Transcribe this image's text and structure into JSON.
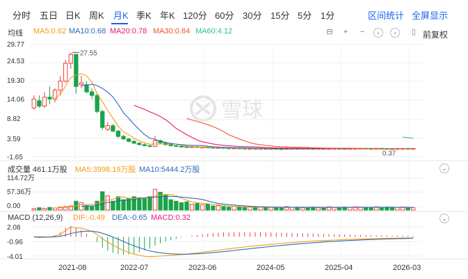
{
  "tabs": [
    {
      "label": "分时",
      "active": false
    },
    {
      "label": "五日",
      "active": false
    },
    {
      "label": "日K",
      "active": false
    },
    {
      "label": "周K",
      "active": false
    },
    {
      "label": "月K",
      "active": true
    },
    {
      "label": "季K",
      "active": false
    },
    {
      "label": "年K",
      "active": false
    },
    {
      "label": "120分",
      "active": false
    },
    {
      "label": "60分",
      "active": false
    },
    {
      "label": "30分",
      "active": false
    },
    {
      "label": "15分",
      "active": false
    },
    {
      "label": "5分",
      "active": false
    },
    {
      "label": "1分",
      "active": false
    }
  ],
  "links": {
    "range_stats": "区间统计",
    "fullscreen": "全屏显示"
  },
  "ma": {
    "label": "均线",
    "ma5": "MA5:0.62",
    "ma10": "MA10:0.68",
    "ma20": "MA20:0.78",
    "ma30": "MA30:0.84",
    "ma60": "MA60:4.12"
  },
  "toolbar": {
    "adjust": "前复权"
  },
  "price_axis": [
    "29.77",
    "24.53",
    "19.30",
    "14.06",
    "8.82",
    "3.59",
    "-1.65"
  ],
  "annotations": {
    "high": "27.55",
    "low": "0.37"
  },
  "volume": {
    "label": "成交量 461.1万股",
    "ma5": "MA5:3998.19万股",
    "ma10": "MA10:5444.2万股",
    "axis": [
      "114.72万",
      "57.36万",
      "0.00"
    ]
  },
  "macd": {
    "label": "MACD (12,26,9)",
    "dif": "DIF:-0.49",
    "dea": "DEA:-0.65",
    "macd": "MACD:0.32",
    "axis": [
      "2.08",
      "-0.96",
      "-4.01"
    ]
  },
  "x_axis": [
    "2021-08",
    "2022-07",
    "2023-06",
    "2024-05",
    "2025-04",
    "2026-03"
  ],
  "watermark": "雪球",
  "colors": {
    "up": "#e8413e",
    "down": "#1aa34a",
    "accent": "#1764e8",
    "ma5": "#f39c12",
    "ma10": "#2d6bb8",
    "ma20": "#e6187a",
    "ma30": "#f0542d",
    "ma60": "#2ec27e"
  },
  "chart_data": {
    "type": "candlestick",
    "period": "monthly",
    "price_range": [
      -1.65,
      29.77
    ],
    "candles": [
      {
        "o": 12.0,
        "c": 14.5,
        "h": 15.5,
        "l": 11.5
      },
      {
        "o": 14.0,
        "c": 12.5,
        "h": 15.5,
        "l": 12.0
      },
      {
        "o": 12.5,
        "c": 15.0,
        "h": 16.5,
        "l": 12.0
      },
      {
        "o": 15.0,
        "c": 14.5,
        "h": 18.0,
        "l": 13.0
      },
      {
        "o": 14.5,
        "c": 17.0,
        "h": 17.5,
        "l": 13.5
      },
      {
        "o": 17.0,
        "c": 19.5,
        "h": 21.0,
        "l": 15.5
      },
      {
        "o": 19.5,
        "c": 24.5,
        "h": 25.5,
        "l": 19.0
      },
      {
        "o": 24.5,
        "c": 27.0,
        "h": 27.55,
        "l": 23.0
      },
      {
        "o": 27.0,
        "c": 18.0,
        "h": 27.0,
        "l": 16.0
      },
      {
        "o": 18.5,
        "c": 19.0,
        "h": 21.0,
        "l": 17.5
      },
      {
        "o": 18.5,
        "c": 16.5,
        "h": 19.5,
        "l": 16.0
      },
      {
        "o": 16.5,
        "c": 15.5,
        "h": 17.5,
        "l": 14.5
      },
      {
        "o": 15.5,
        "c": 11.0,
        "h": 16.0,
        "l": 10.5
      },
      {
        "o": 11.0,
        "c": 6.5,
        "h": 11.5,
        "l": 5.8
      },
      {
        "o": 6.0,
        "c": 7.0,
        "h": 8.0,
        "l": 5.5
      },
      {
        "o": 7.0,
        "c": 5.5,
        "h": 7.5,
        "l": 5.2
      },
      {
        "o": 5.5,
        "c": 4.0,
        "h": 5.8,
        "l": 3.5
      },
      {
        "o": 4.0,
        "c": 3.3,
        "h": 4.5,
        "l": 3.0
      },
      {
        "o": 3.3,
        "c": 2.6,
        "h": 3.6,
        "l": 2.3
      },
      {
        "o": 2.6,
        "c": 2.1,
        "h": 3.0,
        "l": 1.8
      },
      {
        "o": 2.1,
        "c": 1.7,
        "h": 2.4,
        "l": 1.5
      },
      {
        "o": 1.7,
        "c": 1.4,
        "h": 2.0,
        "l": 1.2
      },
      {
        "o": 1.4,
        "c": 1.2,
        "h": 1.6,
        "l": 0.9
      },
      {
        "o": 1.2,
        "c": 2.8,
        "h": 4.2,
        "l": 1.1
      },
      {
        "o": 2.8,
        "c": 2.2,
        "h": 3.1,
        "l": 1.8
      },
      {
        "o": 2.2,
        "c": 1.7,
        "h": 2.5,
        "l": 1.4
      },
      {
        "o": 1.7,
        "c": 1.4,
        "h": 1.9,
        "l": 1.2
      },
      {
        "o": 1.4,
        "c": 1.2,
        "h": 1.6,
        "l": 1.0
      },
      {
        "o": 1.2,
        "c": 1.1,
        "h": 1.4,
        "l": 0.9
      },
      {
        "o": 1.1,
        "c": 0.9,
        "h": 1.3,
        "l": 0.8
      },
      {
        "o": 0.9,
        "c": 1.1,
        "h": 1.3,
        "l": 0.8
      },
      {
        "o": 1.1,
        "c": 0.9,
        "h": 1.2,
        "l": 0.8
      },
      {
        "o": 0.9,
        "c": 1.0,
        "h": 1.2,
        "l": 0.8
      },
      {
        "o": 1.0,
        "c": 0.9,
        "h": 1.2,
        "l": 0.8
      },
      {
        "o": 0.9,
        "c": 0.8,
        "h": 1.0,
        "l": 0.7
      },
      {
        "o": 0.8,
        "c": 0.85,
        "h": 1.0,
        "l": 0.7
      },
      {
        "o": 0.85,
        "c": 0.75,
        "h": 0.95,
        "l": 0.65
      },
      {
        "o": 0.75,
        "c": 0.7,
        "h": 0.85,
        "l": 0.6
      },
      {
        "o": 0.7,
        "c": 0.72,
        "h": 0.85,
        "l": 0.6
      },
      {
        "o": 0.72,
        "c": 0.65,
        "h": 0.8,
        "l": 0.55
      },
      {
        "o": 0.65,
        "c": 0.6,
        "h": 0.75,
        "l": 0.5
      },
      {
        "o": 0.6,
        "c": 0.62,
        "h": 0.7,
        "l": 0.5
      },
      {
        "o": 0.62,
        "c": 0.55,
        "h": 0.7,
        "l": 0.45
      },
      {
        "o": 0.55,
        "c": 0.6,
        "h": 0.7,
        "l": 0.5
      },
      {
        "o": 0.6,
        "c": 0.55,
        "h": 0.65,
        "l": 0.45
      },
      {
        "o": 0.55,
        "c": 0.58,
        "h": 0.66,
        "l": 0.48
      },
      {
        "o": 0.58,
        "c": 0.52,
        "h": 0.62,
        "l": 0.45
      },
      {
        "o": 0.52,
        "c": 0.5,
        "h": 0.58,
        "l": 0.42
      },
      {
        "o": 0.5,
        "c": 0.55,
        "h": 0.9,
        "l": 0.45
      },
      {
        "o": 0.55,
        "c": 0.6,
        "h": 0.7,
        "l": 0.5
      },
      {
        "o": 0.6,
        "c": 0.58,
        "h": 0.66,
        "l": 0.5
      },
      {
        "o": 0.58,
        "c": 0.62,
        "h": 0.7,
        "l": 0.52
      },
      {
        "o": 0.62,
        "c": 0.6,
        "h": 0.68,
        "l": 0.52
      },
      {
        "o": 0.6,
        "c": 0.58,
        "h": 0.66,
        "l": 0.5
      },
      {
        "o": 0.58,
        "c": 0.6,
        "h": 0.66,
        "l": 0.5
      },
      {
        "o": 0.6,
        "c": 0.57,
        "h": 0.65,
        "l": 0.5
      },
      {
        "o": 0.57,
        "c": 0.6,
        "h": 0.66,
        "l": 0.5
      },
      {
        "o": 0.6,
        "c": 0.62,
        "h": 0.7,
        "l": 0.52
      },
      {
        "o": 0.62,
        "c": 0.6,
        "h": 0.68,
        "l": 0.52
      },
      {
        "o": 0.6,
        "c": 0.58,
        "h": 0.66,
        "l": 0.5
      },
      {
        "o": 0.58,
        "c": 0.6,
        "h": 0.66,
        "l": 0.5
      },
      {
        "o": 0.6,
        "c": 0.62,
        "h": 0.7,
        "l": 0.52
      },
      {
        "o": 0.62,
        "c": 0.66,
        "h": 0.72,
        "l": 0.56
      },
      {
        "o": 0.66,
        "c": 0.6,
        "h": 0.7,
        "l": 0.52
      },
      {
        "o": 0.6,
        "c": 0.58,
        "h": 0.66,
        "l": 0.5
      },
      {
        "o": 0.58,
        "c": 0.62,
        "h": 0.68,
        "l": 0.52
      },
      {
        "o": 0.62,
        "c": 0.6,
        "h": 0.7,
        "l": 0.52
      },
      {
        "o": 0.6,
        "c": 0.58,
        "h": 0.66,
        "l": 0.5
      },
      {
        "o": 0.58,
        "c": 0.55,
        "h": 0.62,
        "l": 0.37
      },
      {
        "o": 0.55,
        "c": 0.6,
        "h": 0.68,
        "l": 0.5
      },
      {
        "o": 0.6,
        "c": 0.62,
        "h": 0.7,
        "l": 0.55
      },
      {
        "o": 0.62,
        "c": 0.6,
        "h": 0.66,
        "l": 0.55
      },
      {
        "o": 0.6,
        "c": 0.62,
        "h": 0.68,
        "l": 0.56
      }
    ],
    "ma_lines": {
      "ma60": [
        [
          70,
          3.8
        ],
        [
          73,
          3.5
        ]
      ]
    },
    "volume_range": [
      0,
      114.72
    ],
    "volume": [
      5,
      8,
      6,
      9,
      7,
      10,
      12,
      14,
      30,
      25,
      15,
      12,
      30,
      62,
      48,
      30,
      45,
      35,
      40,
      45,
      42,
      38,
      45,
      70,
      60,
      50,
      35,
      30,
      25,
      28,
      20,
      22,
      18,
      20,
      14,
      15,
      12,
      10,
      13,
      11,
      9,
      10,
      8,
      11,
      9,
      10,
      8,
      7,
      12,
      9,
      10,
      8,
      9,
      10,
      8,
      9,
      11,
      9,
      8,
      10,
      9,
      11,
      10,
      8,
      9,
      11,
      9,
      10,
      8,
      9,
      10,
      9,
      8
    ],
    "macd_range": [
      -4.01,
      2.08
    ]
  }
}
